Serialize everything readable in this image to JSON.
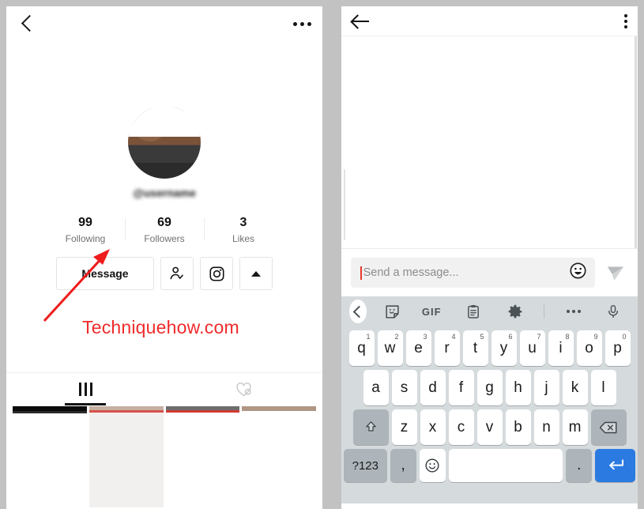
{
  "profile_panel": {
    "header": {
      "back_icon": "chevron-left-icon",
      "title": "",
      "menu_icon": "more-horizontal-icon"
    },
    "avatar": {
      "alt": "profile-photo"
    },
    "handle": "@username",
    "stats": [
      {
        "count": "99",
        "label": "Following"
      },
      {
        "count": "69",
        "label": "Followers"
      },
      {
        "count": "3",
        "label": "Likes"
      }
    ],
    "actions": {
      "message_label": "Message",
      "follow_icon": "person-check-icon",
      "instagram_icon": "instagram-icon",
      "more_icon": "caret-up-icon"
    },
    "annotation": {
      "watermark": "Techniquehow.com",
      "watermark_color": "#ef2b2b",
      "arrow_color": "#ee1c1c",
      "arrow_points_to": "Message"
    },
    "tabs": [
      {
        "icon": "grid-icon",
        "active": true
      },
      {
        "icon": "private-heart-icon",
        "active": false
      }
    ]
  },
  "chat_panel": {
    "header": {
      "back_icon": "arrow-left-icon",
      "title": "",
      "menu_icon": "more-vertical-icon"
    },
    "input": {
      "value": "",
      "placeholder": "Send a message...",
      "emoji_icon": "emoji-face-icon",
      "send_icon": "send-plane-icon",
      "cursor_color": "#e8372c"
    },
    "keyboard": {
      "toolbar": [
        {
          "name": "back-chevron",
          "label": ""
        },
        {
          "name": "sticker-icon",
          "label": ""
        },
        {
          "name": "gif-icon",
          "label": "GIF"
        },
        {
          "name": "clipboard-icon",
          "label": ""
        },
        {
          "name": "settings-gear-icon",
          "label": ""
        },
        {
          "name": "more-dots-icon",
          "label": ""
        },
        {
          "name": "microphone-icon",
          "label": ""
        }
      ],
      "row1": [
        {
          "k": "q",
          "n": "1"
        },
        {
          "k": "w",
          "n": "2"
        },
        {
          "k": "e",
          "n": "3"
        },
        {
          "k": "r",
          "n": "4"
        },
        {
          "k": "t",
          "n": "5"
        },
        {
          "k": "y",
          "n": "6"
        },
        {
          "k": "u",
          "n": "7"
        },
        {
          "k": "i",
          "n": "8"
        },
        {
          "k": "o",
          "n": "9"
        },
        {
          "k": "p",
          "n": "0"
        }
      ],
      "row2": [
        {
          "k": "a"
        },
        {
          "k": "s"
        },
        {
          "k": "d"
        },
        {
          "k": "f"
        },
        {
          "k": "g"
        },
        {
          "k": "h"
        },
        {
          "k": "j"
        },
        {
          "k": "k"
        },
        {
          "k": "l"
        }
      ],
      "row3": [
        {
          "k": "z"
        },
        {
          "k": "x"
        },
        {
          "k": "c"
        },
        {
          "k": "v"
        },
        {
          "k": "b"
        },
        {
          "k": "n"
        },
        {
          "k": "m"
        }
      ],
      "shift_label": "",
      "backspace_label": "",
      "row4": {
        "numeric_label": "?123",
        "comma_label": ",",
        "emoji_label": "",
        "space_label": "",
        "period_label": ".",
        "enter_label": "",
        "enter_color": "#2a7ae2"
      }
    }
  }
}
